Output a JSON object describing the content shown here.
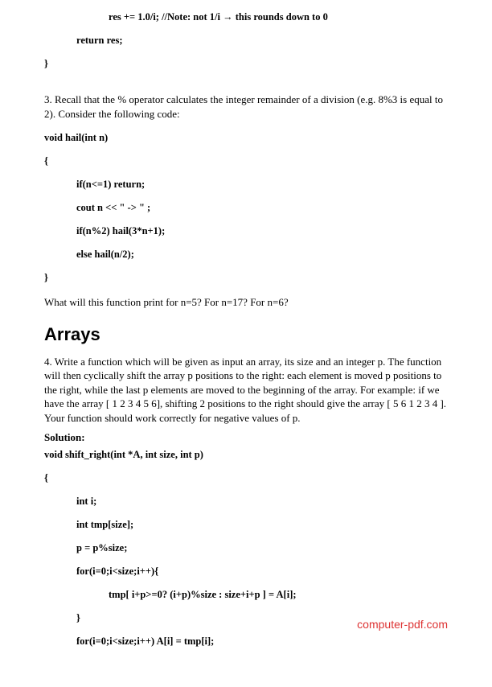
{
  "block1": {
    "l1": "res += 1.0/i; //Note: not 1/i → this rounds down to 0",
    "l2": "return res;",
    "l3": "}"
  },
  "q3": {
    "intro": "3. Recall that the % operator calculates the integer remainder of a division (e.g. 8%3 is equal to 2). Consider the following code:",
    "c1": "void hail(int n)",
    "c2": "{",
    "c3": "if(n<=1) return;",
    "c4": "cout n << \" -> \" ;",
    "c5": "if(n%2) hail(3*n+1);",
    "c6": "else hail(n/2);",
    "c7": "}",
    "after": "What will this function print for n=5? For n=17? For n=6?"
  },
  "arrays": {
    "heading": "Arrays",
    "q4": "4. Write a function which will be given as input an array, its size and an integer p. The function will then cyclically shift the array p positions to the right: each element is moved p positions to the right, while the last p elements are moved to the beginning of the array. For example: if we have the array [ 1 2 3 4 5 6], shifting 2 positions to the right should give the array [ 5 6 1 2 3 4 ]. Your function should work correctly for negative values of p.",
    "solution_label": "Solution:",
    "c1": "void shift_right(int *A, int size, int p)",
    "c2": "{",
    "c3": "int i;",
    "c4": "int tmp[size];",
    "c5": "p = p%size;",
    "c6": "for(i=0;i<size;i++){",
    "c7": "tmp[ i+p>=0? (i+p)%size : size+i+p ] = A[i];",
    "c8": "}",
    "c9": "for(i=0;i<size;i++) A[i] = tmp[i];"
  },
  "footer": "computer-pdf.com"
}
